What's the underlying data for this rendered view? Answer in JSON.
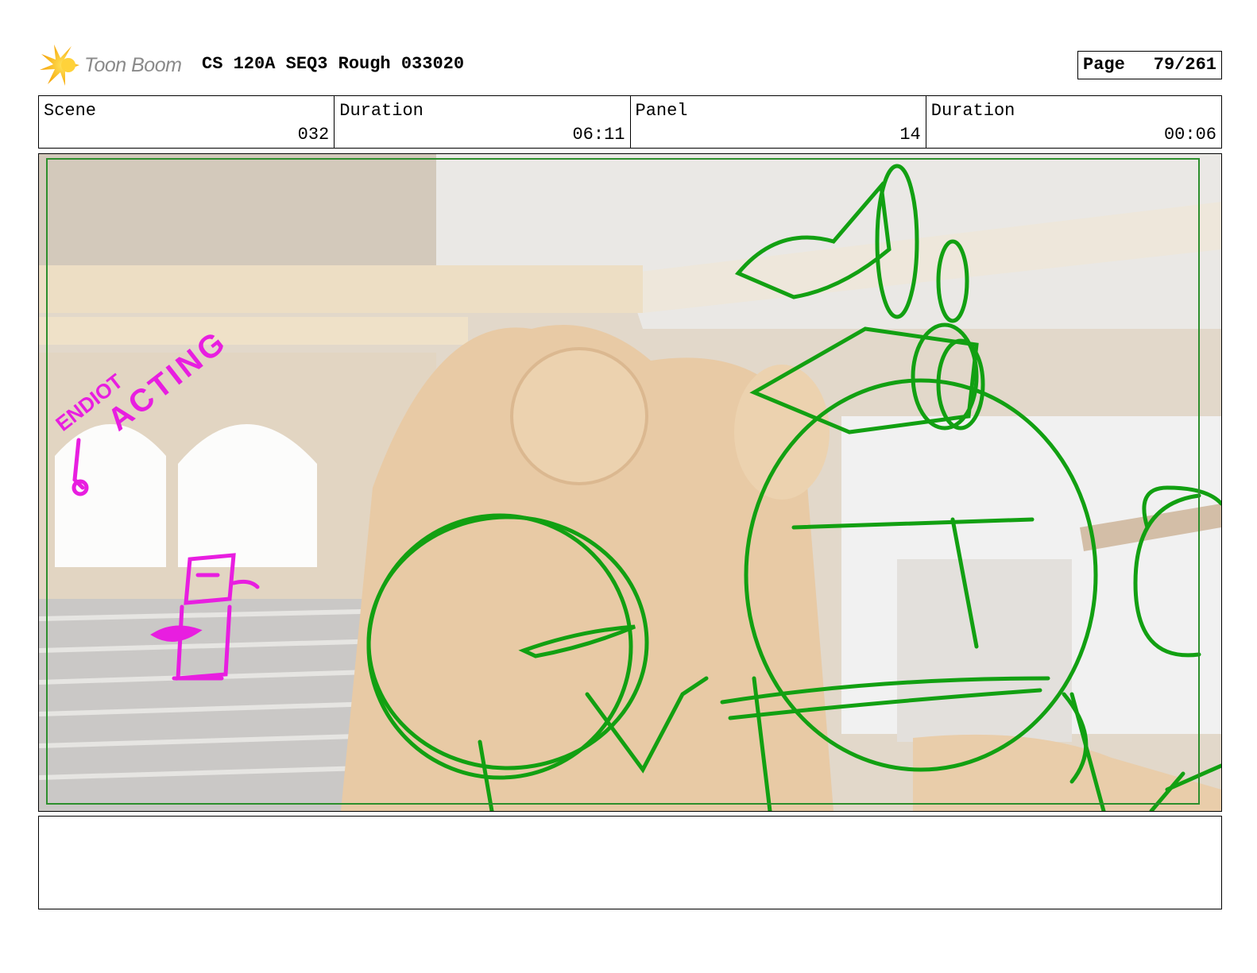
{
  "header": {
    "logo_text": "Toon Boom",
    "title": "CS 120A SEQ3 Rough 033020",
    "page_label": "Page",
    "page_value": "79/261"
  },
  "info": {
    "scene_label": "Scene",
    "scene_value": "032",
    "scene_duration_label": "Duration",
    "scene_duration_value": "06:11",
    "panel_label": "Panel",
    "panel_value": "14",
    "panel_duration_label": "Duration",
    "panel_duration_value": "00:06"
  },
  "sketch": {
    "annotation_1": "ENDIOT",
    "annotation_2": "ACTING",
    "annotation_color": "#e81ee0",
    "rough_color": "#12a012",
    "safe_frame_color": "#2d8f2d"
  },
  "notes": {
    "text": ""
  }
}
